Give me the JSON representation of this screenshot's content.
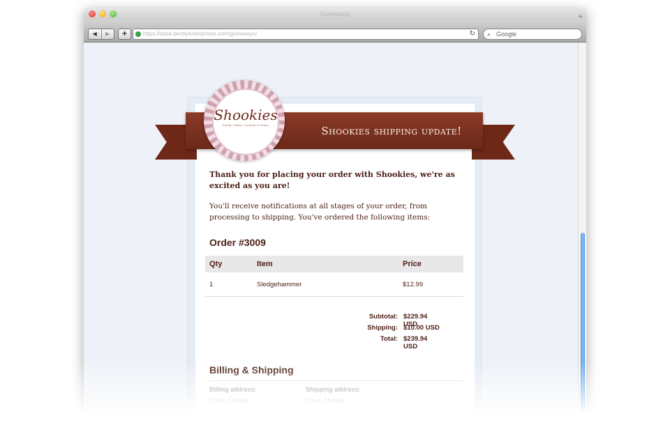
{
  "browser": {
    "window_title": "Giveaways",
    "url": "https://base.bentlyenterprises.com/giveaways/",
    "search_placeholder": "Google",
    "back_label": "◀",
    "forward_label": "▶",
    "add_label": "+",
    "reload_label": "↻"
  },
  "email": {
    "brand_name": "Shookies",
    "brand_tagline": "Candy, Cakes, Cookies & Pastry",
    "banner_title": "Shookies shipping update!",
    "intro": "Thank you for placing your order with Shookies, we're as excited as you are!",
    "body": "You'll receive notifications at all stages of your order, from processing to shipping. You've ordered the following items:",
    "order_title": "Order #3009",
    "table": {
      "headers": [
        "Qty",
        "Item",
        "Price"
      ],
      "rows": [
        {
          "qty": "1",
          "item": "Sledgehammer",
          "price": "$12.99"
        }
      ]
    },
    "totals": [
      {
        "label": "Subtotal:",
        "value": "$229.94 USD"
      },
      {
        "label": "Shipping:",
        "value": "$10.00 USD"
      },
      {
        "label": "Total:",
        "value": "$239.94 USD"
      }
    ],
    "billing_title": "Billing & Shipping",
    "billing_label": "Billing address:",
    "billing_name": "Steve Shipper",
    "shipping_label": "Shipping address:",
    "shipping_name": "Steve Shipper"
  },
  "colors": {
    "brand_brown": "#6c2818",
    "text_brown": "#4a1e14",
    "scroll_blue": "#4b93e6"
  }
}
